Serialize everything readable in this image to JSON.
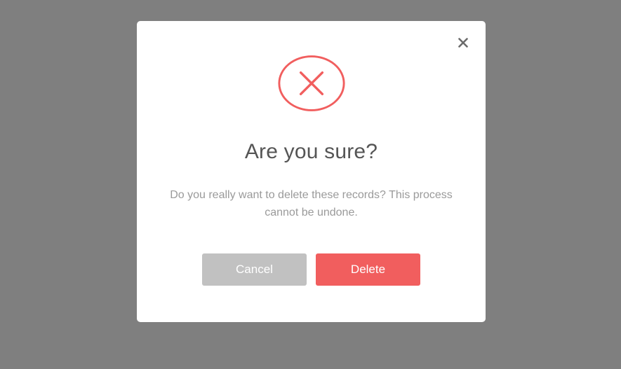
{
  "dialog": {
    "title": "Are you sure?",
    "message": "Do you really want to delete these records? This process cannot be undone.",
    "cancel_label": "Cancel",
    "delete_label": "Delete",
    "icon": "x-circle-icon",
    "close_icon": "close-icon"
  },
  "colors": {
    "overlay": "#7f7f7f",
    "modal_bg": "#ffffff",
    "danger": "#f15e5e",
    "cancel_bg": "#c1c1c1",
    "title_text": "#555555",
    "message_text": "#9a9a9a",
    "close_icon": "#6b6b6b"
  }
}
